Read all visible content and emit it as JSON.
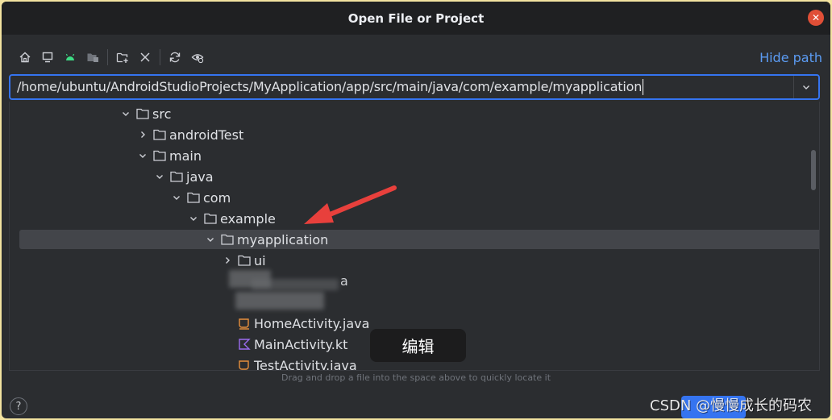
{
  "dialog": {
    "title": "Open File or Project",
    "hide_path_label": "Hide path",
    "path_value": "/home/ubuntu/AndroidStudioProjects/MyApplication/app/src/main/java/com/example/myapplication",
    "drag_hint": "Drag and drop a file into the space above to quickly locate it",
    "help_label": "?",
    "close_label": "✕"
  },
  "toolbar": {
    "icons": [
      "home-icon",
      "desktop-icon",
      "android-icon",
      "project-folder-icon",
      "new-folder-icon",
      "delete-icon",
      "refresh-icon",
      "show-hidden-icon"
    ]
  },
  "tree": {
    "items": [
      {
        "label": "src",
        "kind": "folder",
        "expanded": true
      },
      {
        "label": "androidTest",
        "kind": "folder",
        "expanded": false
      },
      {
        "label": "main",
        "kind": "folder",
        "expanded": true
      },
      {
        "label": "java",
        "kind": "folder",
        "expanded": true
      },
      {
        "label": "com",
        "kind": "folder",
        "expanded": true
      },
      {
        "label": "example",
        "kind": "folder",
        "expanded": true
      },
      {
        "label": "myapplication",
        "kind": "folder",
        "expanded": true,
        "selected": true
      },
      {
        "label": "ui",
        "kind": "folder",
        "expanded": false
      },
      {
        "label": "a",
        "kind": "obscured"
      },
      {
        "label": "",
        "kind": "obscured"
      },
      {
        "label": "HomeActivity.java",
        "kind": "java"
      },
      {
        "label": "MainActivity.kt",
        "kind": "kotlin"
      },
      {
        "label": "TestActivity.java",
        "kind": "java"
      }
    ]
  },
  "overlay": {
    "tooltip": "编辑",
    "watermark": "CSDN @慢慢成长的码农"
  },
  "colors": {
    "accent": "#3574f0",
    "link": "#5b9bf2",
    "annotation_arrow": "#e8403c",
    "java_icon": "#e8903c",
    "kotlin_icon": "#9b6cf0"
  }
}
